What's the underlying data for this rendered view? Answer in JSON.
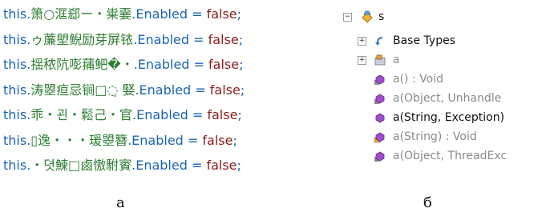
{
  "code_lines": [
    {
      "this": "this.",
      "obj": "箫○洭郄ー・粜嫑",
      "prop": ".Enabled",
      "eq": " = ",
      "val": "false",
      "semi": ";"
    },
    {
      "this": "this.",
      "obj": "ゥ薕塱鲵励芽屏铱",
      "prop": ".Enabled",
      "eq": " = ",
      "val": "false",
      "semi": ";"
    },
    {
      "this": "this.",
      "obj": "揺秾阬嘭蒱鲃�・.",
      "prop": "Enabled",
      "eq": " = ",
      "val": "false",
      "semi": ";"
    },
    {
      "this": "this.",
      "obj": "涛曌疸忌锏□◌̣ 婜",
      "prop": ".Enabled",
      "eq": " = ",
      "val": "false",
      "semi": ";"
    },
    {
      "this": "this.",
      "obj": "乖・괸・鬆己・官",
      "prop": ".Enabled",
      "eq": " = ",
      "val": "false",
      "semi": ";"
    },
    {
      "this": "this.",
      "obj": "▯逸・・・瑗曌簪",
      "prop": ".Enabled",
      "eq": " = ",
      "val": "false",
      "semi": ";"
    },
    {
      "this": "this.",
      "obj": "・뎟鰊□鹵慠駙賨",
      "prop": ".Enabled",
      "eq": " = ",
      "val": "false",
      "semi": ";"
    }
  ],
  "tree": {
    "root": {
      "label": "s",
      "icon": "class-icon"
    },
    "items": [
      {
        "label": "Base Types",
        "icon": "base-types-icon",
        "style": "dark"
      },
      {
        "label": "a",
        "icon": "class-icon",
        "style": "gray"
      },
      {
        "label": "a() : Void",
        "icon": "method-icon",
        "style": "gray"
      },
      {
        "label": "a(Object, Unhandle",
        "icon": "method-icon",
        "style": "gray"
      },
      {
        "label": "a(String, Exception)",
        "icon": "method-icon",
        "style": "dark"
      },
      {
        "label": "a(String) : Void",
        "icon": "method-icon",
        "style": "gray"
      },
      {
        "label": "a(Object, ThreadExc",
        "icon": "method-icon",
        "style": "gray"
      }
    ]
  },
  "captions": {
    "left": "а",
    "right": "б"
  },
  "colors": {
    "keyword": "#1a64b4",
    "identifier": "#2e7d32",
    "value": "#8b1a1a",
    "tree_gray": "#8a8a8a"
  }
}
